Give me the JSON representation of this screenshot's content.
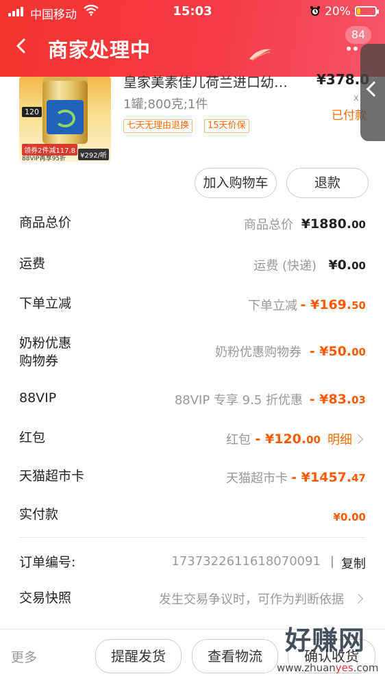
{
  "status_bar": {
    "carrier": "中国移动",
    "time": "15:03",
    "battery_percent": "20%",
    "battery_level": 0.2,
    "battery_color": "#ffd200"
  },
  "header": {
    "title": "商家处理中",
    "back_icon": "chevron-left-icon",
    "message_count": "84",
    "brand_color": "#f4342f"
  },
  "product": {
    "title": "皇家美素佳儿荷兰进口幼…",
    "price": "¥378.0",
    "quantity": "x",
    "spec": "1罐;800克;1件",
    "status": "已付款",
    "tags": [
      "七天无理由退换",
      "15天价保"
    ],
    "image_texts": {
      "price_tag": "120",
      "coupon": "领券2件减117.8",
      "vip": "88VIP再享95折",
      "per_unit": "¥292/听"
    }
  },
  "actions": {
    "add_to_cart": "加入购物车",
    "refund": "退款"
  },
  "price_rows": [
    {
      "label": "商品总价",
      "desc": "商品总价",
      "amount_main": "¥1880.",
      "amount_small": "00"
    },
    {
      "label": "运费",
      "desc": "运费 (快递)",
      "amount_main": "¥0.",
      "amount_small": "00"
    },
    {
      "label": "下单立减",
      "desc": "下单立减",
      "amount_main": "- ¥169.",
      "amount_small": "50"
    },
    {
      "label": "奶粉优惠\n购物券",
      "desc": "奶粉优惠购物券",
      "amount_main": "- ¥50.",
      "amount_small": "00"
    },
    {
      "label": "88VIP",
      "desc": "88VIP 专享 9.5 折优惠",
      "amount_main": "- ¥83.",
      "amount_small": "03"
    },
    {
      "label": "红包",
      "desc": "红包",
      "amount_main": "- ¥120.",
      "amount_small": "00",
      "link": "明细"
    },
    {
      "label": "天猫超市卡",
      "desc": "天猫超市卡",
      "amount_main": "- ¥1457.",
      "amount_small": "47"
    },
    {
      "label": "实付款",
      "desc": "",
      "amount_main": "¥0.",
      "amount_small": "00"
    }
  ],
  "order": {
    "number_label": "订单编号:",
    "number": "1737322611618070091",
    "separator": "|",
    "copy": "复制",
    "snapshot_label": "交易快照",
    "snapshot_desc": "发生交易争议时，可作为判断依据"
  },
  "bottom_bar": {
    "more": "更多",
    "remind": "提醒发货",
    "logistics": "查看物流",
    "third": "确认收货"
  },
  "watermark": {
    "logo": "好赚网",
    "url_pre": "www.zhuan",
    "url_hl": "yes",
    "url_post": ".com"
  },
  "accent_color": "#ff5a00"
}
